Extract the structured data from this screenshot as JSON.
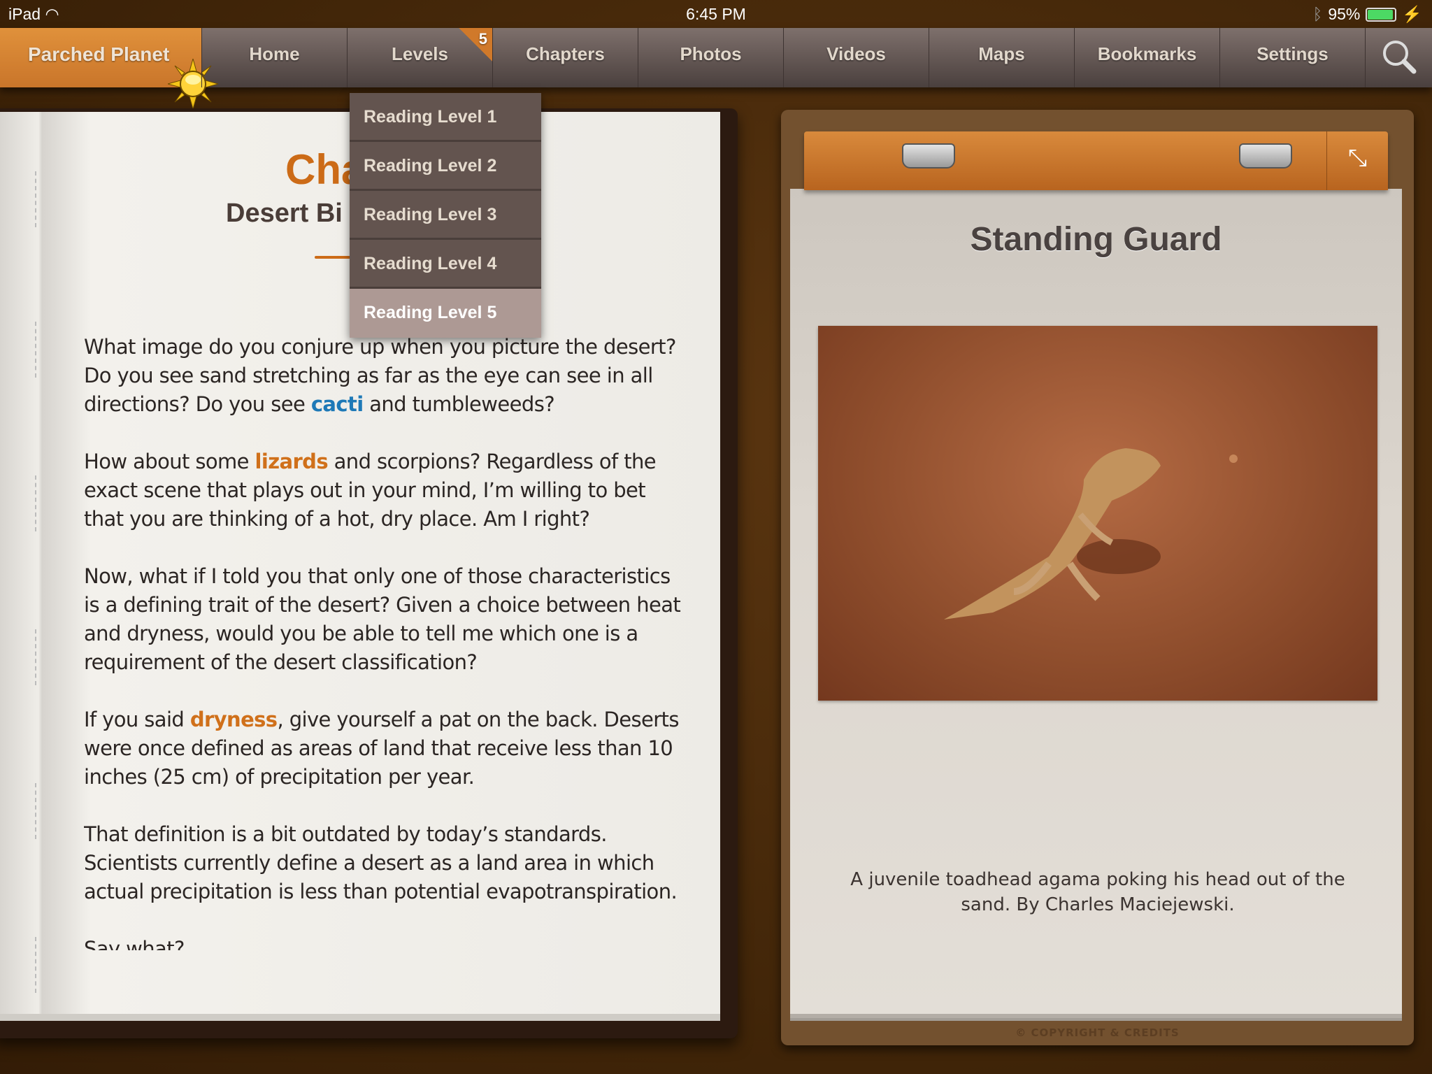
{
  "status_bar": {
    "device": "iPad",
    "time": "6:45 PM",
    "battery": "95%",
    "battery_level": 0.95,
    "icons": [
      "wifi-icon",
      "bluetooth-icon",
      "battery-icon",
      "charging-icon"
    ]
  },
  "nav": {
    "brand": "Parched Planet",
    "items": [
      "Home",
      "Levels",
      "Chapters",
      "Photos",
      "Videos",
      "Maps",
      "Bookmarks",
      "Settings"
    ],
    "levels_badge": "5",
    "search_icon": "magnifier-icon"
  },
  "dropdown": {
    "items": [
      "Reading Level 1",
      "Reading Level 2",
      "Reading Level 3",
      "Reading Level 4",
      "Reading Level 5"
    ],
    "selected": "Reading Level 5"
  },
  "chapter": {
    "title_visible": "Cha",
    "subtitle_visible": "Desert Bi",
    "paragraphs": [
      {
        "before": "What image do you conjure up when you picture the desert? Do you see sand stretching as far as the eye can see in all directions? Do you see ",
        "link": "cacti",
        "after": " and tumbleweeds?"
      },
      {
        "before": "How about some ",
        "link": "lizards",
        "after": " and scorpions? Regardless of the exact scene that plays out in your mind, I’m willing to bet that you are thinking of a hot, dry place. Am I right?"
      },
      {
        "before": "Now, what if I told you that only one of those characteristics is a defining trait of the desert? Given a choice between heat and dryness, would you be able to tell me which one is a requirement of the desert classification?",
        "link": "",
        "after": ""
      },
      {
        "before": "If you said ",
        "link": "dryness",
        "after": ", give yourself a pat on the back. Deserts were once defined as areas of land that receive less than 10 inches (25 cm) of precipitation per year."
      },
      {
        "before": "That definition is a bit outdated by today’s standards. Scientists currently define a desert as a land area in which actual precipitation is less than potential evapotranspiration.",
        "link": "",
        "after": ""
      },
      {
        "before": "Say what?",
        "link": "",
        "after": ""
      }
    ]
  },
  "photo_panel": {
    "title": "Standing Guard",
    "caption": "A juvenile toadhead agama poking his head out of the sand. By Charles Maciejewski.",
    "expand_icon": "expand-icon",
    "footer": "© COPYRIGHT & CREDITS"
  },
  "colors": {
    "accent": "#cc6b17",
    "link_blue": "#1e79b7",
    "nav": "#5f5350"
  }
}
